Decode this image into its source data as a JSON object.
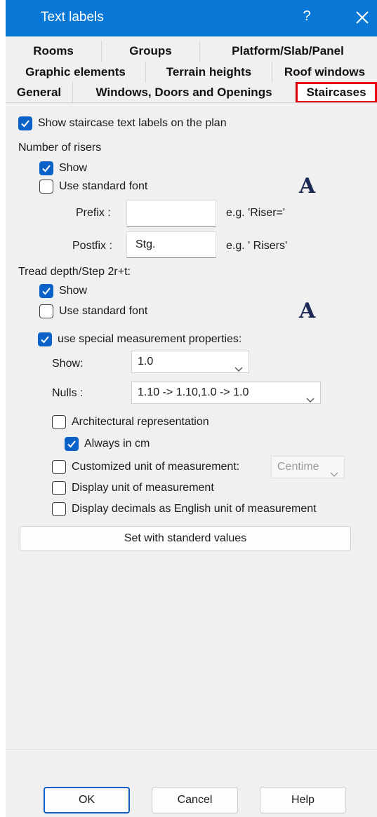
{
  "window": {
    "title": "Text labels",
    "help_glyph": "?"
  },
  "tabs": {
    "row1": [
      "Rooms",
      "Groups",
      "Platform/Slab/Panel"
    ],
    "row2": [
      "Graphic elements",
      "Terrain heights",
      "Roof windows"
    ],
    "row3": [
      "General",
      "Windows, Doors and Openings",
      "Staircases"
    ],
    "active": "Staircases",
    "highlight_color": "#e8000f"
  },
  "show_staircase_labels": {
    "label": "Show staircase text labels on the plan",
    "checked": true
  },
  "risers": {
    "heading": "Number of risers",
    "show": {
      "label": "Show",
      "checked": true
    },
    "standard_font": {
      "label": "Use standard font",
      "checked": false
    },
    "font_glyph": "A",
    "prefix": {
      "label": "Prefix :",
      "value": "",
      "hint": "e.g. 'Riser='"
    },
    "postfix": {
      "label": "Postfix :",
      "value": "Stg.",
      "hint": "e.g. ' Risers'"
    }
  },
  "tread": {
    "heading": "Tread depth/Step 2r+t:",
    "show": {
      "label": "Show",
      "checked": true
    },
    "standard_font": {
      "label": "Use standard font",
      "checked": false
    },
    "font_glyph": "A",
    "special": {
      "label": "use special measurement properties:",
      "checked": true
    },
    "show_combo": {
      "label": "Show:",
      "value": "1.0"
    },
    "nulls_combo": {
      "label": "Nulls :",
      "value": "1.10 -> 1.10,1.0 -> 1.0"
    },
    "architectural": {
      "label": "Architectural representation",
      "checked": false
    },
    "always_cm": {
      "label": "Always in cm",
      "checked": true
    },
    "customized_unit": {
      "label": "Customized unit of measurement:",
      "checked": false,
      "unit_value": "Centime"
    },
    "display_unit": {
      "label": "Display unit of measurement",
      "checked": false
    },
    "english_decimals": {
      "label": "Display decimals as English unit of measurement",
      "checked": false
    },
    "set_standard_button": "Set with standerd values"
  },
  "footer": {
    "ok": "OK",
    "cancel": "Cancel",
    "help": "Help"
  },
  "colors": {
    "titlebar": "#0a78d7",
    "checkbox_checked": "#0a62c8",
    "dialog_bg": "#f0f0f0"
  }
}
